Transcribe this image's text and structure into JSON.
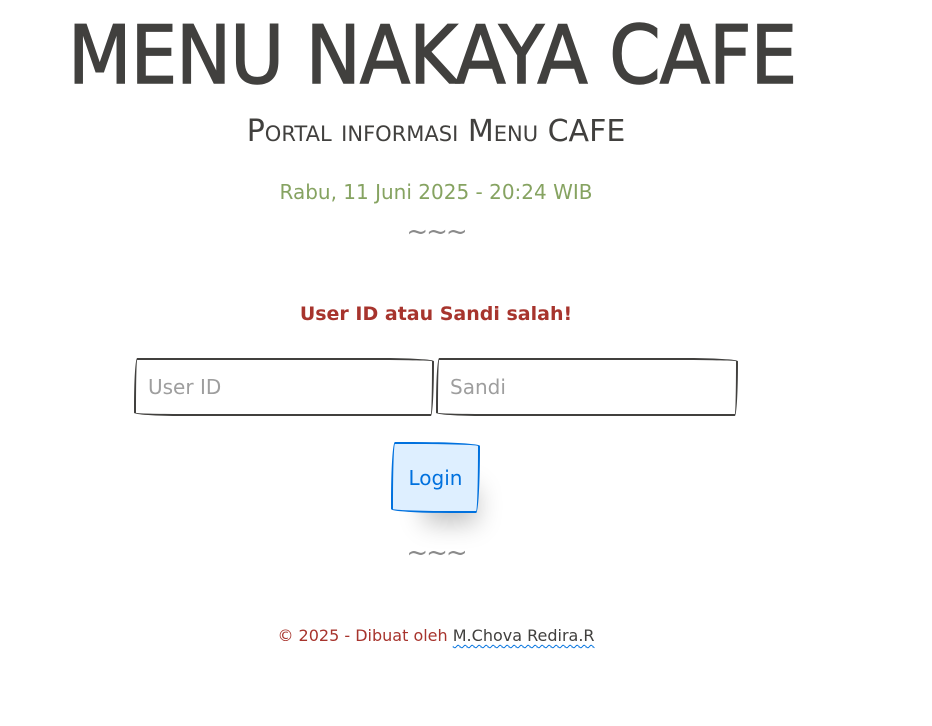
{
  "header": {
    "title": "MENU NAKAYA CAFE",
    "subtitle": "Portal informasi Menu CAFE",
    "datetime": "Rabu, 11 Juni 2025 - 20:24 WIB"
  },
  "divider": "~~~",
  "login": {
    "error_message": "User ID atau Sandi salah!",
    "user_id_placeholder": "User ID",
    "password_placeholder": "Sandi",
    "user_id_value": "",
    "password_value": "",
    "login_label": "Login"
  },
  "footer": {
    "prefix": "© 2025 - Dibuat oleh ",
    "author": "M.Chova Redira.R"
  },
  "colors": {
    "text": "#41403e",
    "datetime": "#86a361",
    "error": "#a7342d",
    "button_border": "#0071de",
    "button_bg": "#deefff"
  }
}
